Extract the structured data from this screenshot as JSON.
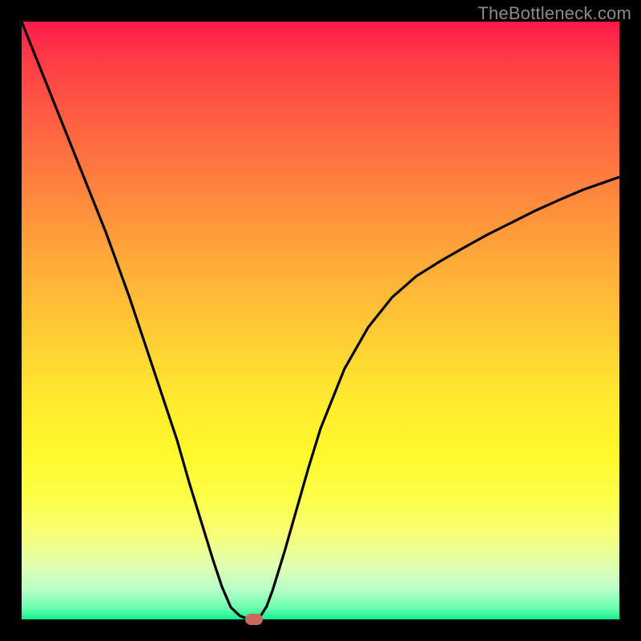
{
  "watermark": "TheBottleneck.com",
  "colors": {
    "frame": "#000000",
    "gradient_top": "#ff1a4b",
    "gradient_bottom": "#14f08c",
    "curve": "#000000",
    "marker": "#c86a5e"
  },
  "chart_data": {
    "type": "line",
    "title": "",
    "xlabel": "",
    "ylabel": "",
    "xlim": [
      0,
      100
    ],
    "ylim": [
      0,
      100
    ],
    "series": [
      {
        "name": "curve",
        "x": [
          0,
          2,
          4,
          6,
          8,
          10,
          12,
          14,
          16,
          18,
          20,
          22,
          24,
          26,
          28,
          30,
          32,
          33.5,
          35,
          36.5,
          38,
          38.5,
          39,
          40,
          41,
          42,
          44,
          46,
          48,
          50,
          54,
          58,
          62,
          66,
          70,
          74,
          78,
          82,
          86,
          90,
          94,
          98,
          100
        ],
        "y": [
          100,
          95,
          90,
          85,
          80,
          75,
          70,
          65,
          59.5,
          54,
          48,
          42,
          36,
          30,
          23,
          16.5,
          10,
          5.5,
          2,
          0.6,
          0,
          0,
          0,
          0.6,
          2.2,
          4.9,
          11.4,
          18.4,
          25.4,
          31.9,
          41.9,
          48.9,
          53.9,
          57.4,
          59.9,
          62.2,
          64.4,
          66.4,
          68.4,
          70.2,
          71.9,
          73.3,
          74
        ]
      }
    ],
    "marker": {
      "x": 38.9,
      "y": 0
    },
    "gradient_stops": [
      {
        "pos": 0.0,
        "color": "#ff1a4b"
      },
      {
        "pos": 0.06,
        "color": "#ff3a47"
      },
      {
        "pos": 0.15,
        "color": "#ff5a43"
      },
      {
        "pos": 0.25,
        "color": "#ff7a3f"
      },
      {
        "pos": 0.35,
        "color": "#ff9a3b"
      },
      {
        "pos": 0.45,
        "color": "#ffb837"
      },
      {
        "pos": 0.55,
        "color": "#ffd333"
      },
      {
        "pos": 0.63,
        "color": "#ffe92f"
      },
      {
        "pos": 0.72,
        "color": "#fff82b"
      },
      {
        "pos": 0.8,
        "color": "#feff4a"
      },
      {
        "pos": 0.86,
        "color": "#f6ff7a"
      },
      {
        "pos": 0.91,
        "color": "#e0ffb0"
      },
      {
        "pos": 0.95,
        "color": "#b8ffc8"
      },
      {
        "pos": 0.98,
        "color": "#6effb0"
      },
      {
        "pos": 1.0,
        "color": "#14f08c"
      }
    ]
  }
}
